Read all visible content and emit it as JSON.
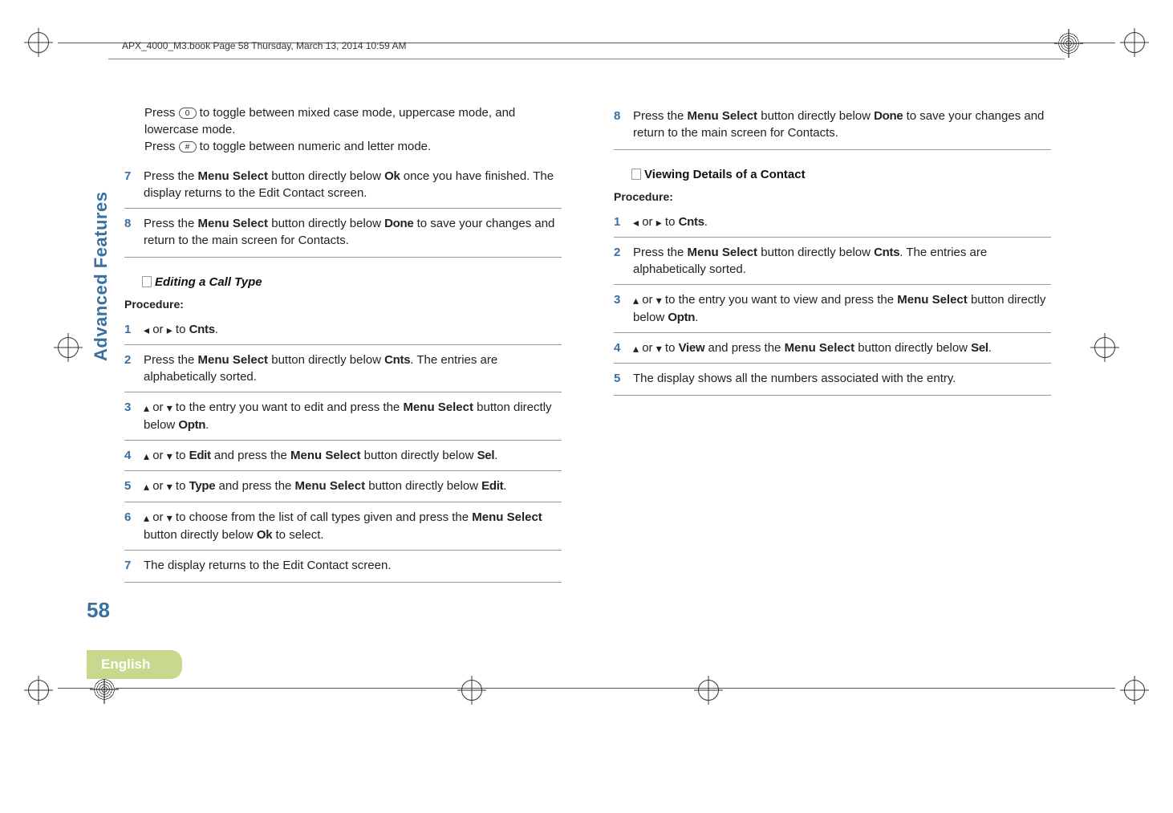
{
  "header": "APX_4000_M3.book  Page 58  Thursday, March 13, 2014  10:59 AM",
  "sidebar_label": "Advanced Features",
  "page_number": "58",
  "language": "English",
  "left": {
    "pre": {
      "line1_a": "Press ",
      "key0": "0  ",
      "line1_b": " to toggle between mixed case mode, uppercase mode, and lowercase mode.",
      "line2_a": "Press ",
      "keyH": "#  ",
      "line2_b": " to toggle between numeric and letter mode."
    },
    "steps_a": [
      {
        "num": "7",
        "a": "Press the ",
        "b": "Menu Select",
        "c": " button directly below ",
        "d": "Ok",
        "e": " once you have finished. The display returns to the Edit Contact screen."
      },
      {
        "num": "8",
        "a": "Press the ",
        "b": "Menu Select",
        "c": " button directly below ",
        "d": "Done",
        "e": " to save your changes and return to the main screen for Contacts."
      }
    ],
    "section_title": "Editing a Call Type",
    "proc": "Procedure:",
    "steps_b": {
      "s1": {
        "num": "1",
        "left": "◂",
        "mid": " or ",
        "right": "▸",
        "a": " to ",
        "d": "Cnts",
        "e": "."
      },
      "s2": {
        "num": "2",
        "a": "Press the ",
        "b": "Menu Select",
        "c": " button directly below ",
        "d": "Cnts",
        "e": ". The entries are alphabetically sorted."
      },
      "s3": {
        "num": "3",
        "up": "▴",
        "mid": " or ",
        "down": "▾",
        "a": " to the entry you want to edit and press the ",
        "b": "Menu Select",
        "c": " button directly below ",
        "d": "Optn",
        "e": "."
      },
      "s4": {
        "num": "4",
        "up": "▴",
        "mid": " or ",
        "down": "▾",
        "a": " to ",
        "d": "Edit",
        "a2": " and press the ",
        "b": "Menu Select",
        "c": " button directly below ",
        "d2": "Sel",
        "e": "."
      },
      "s5": {
        "num": "5",
        "up": "▴",
        "mid": " or ",
        "down": "▾",
        "a": " to ",
        "d": "Type",
        "a2": " and press the ",
        "b": "Menu Select",
        "c": " button directly below ",
        "d2": "Edit",
        "e": "."
      },
      "s6": {
        "num": "6",
        "up": "▴",
        "mid": " or ",
        "down": "▾",
        "a": " to choose from the list of call types given and press the ",
        "b": "Menu Select",
        "c": " button directly below ",
        "d": "Ok",
        "e": " to select."
      },
      "s7": {
        "num": "7",
        "a": "The display returns to the Edit Contact screen."
      }
    }
  },
  "right": {
    "s8": {
      "num": "8",
      "a": "Press the ",
      "b": "Menu Select",
      "c": " button directly below ",
      "d": "Done",
      "e": " to save your changes and return to the main screen for Contacts."
    },
    "section_title": "Viewing Details of a Contact",
    "proc": "Procedure:",
    "steps": {
      "s1": {
        "num": "1",
        "left": "◂",
        "mid": " or ",
        "right": "▸",
        "a": " to ",
        "d": "Cnts",
        "e": "."
      },
      "s2": {
        "num": "2",
        "a": "Press the ",
        "b": "Menu Select",
        "c": " button directly below ",
        "d": "Cnts",
        "e": ". The entries are alphabetically sorted."
      },
      "s3": {
        "num": "3",
        "up": "▴",
        "mid": " or ",
        "down": "▾",
        "a": " to the entry you want to view and press the ",
        "b": "Menu Select",
        "c": " button directly below ",
        "d": "Optn",
        "e": "."
      },
      "s4": {
        "num": "4",
        "up": "▴",
        "mid": " or ",
        "down": "▾",
        "a": " to ",
        "d": "View",
        "a2": " and press the ",
        "b": "Menu Select",
        "c": " button directly below ",
        "d2": "Sel",
        "e": "."
      },
      "s5": {
        "num": "5",
        "a": "The display shows all the numbers associated with the entry."
      }
    }
  }
}
